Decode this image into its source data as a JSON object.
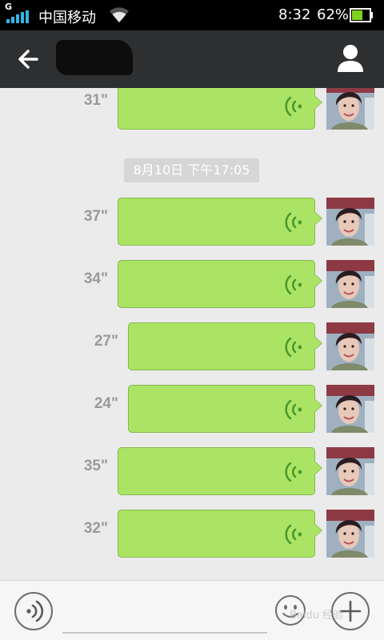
{
  "status_bar": {
    "network_type": "G",
    "carrier": "中国移动",
    "time": "8:32",
    "battery_percent": "62%",
    "battery_level": 0.62,
    "signal_strength": 4,
    "icons": [
      "signal-icon",
      "wifi-icon",
      "battery-icon"
    ]
  },
  "header": {
    "back_icon": "back-arrow-icon",
    "contact_name": "",
    "profile_icon": "person-icon",
    "background": "#2d2f31"
  },
  "chat": {
    "messages": [
      {
        "duration": "31\"",
        "type": "voice",
        "sender": "self"
      },
      {
        "timestamp": "8月10日 下午17:05"
      },
      {
        "duration": "37\"",
        "type": "voice",
        "sender": "self"
      },
      {
        "duration": "34\"",
        "type": "voice",
        "sender": "self"
      },
      {
        "duration": "27\"",
        "type": "voice",
        "sender": "self"
      },
      {
        "duration": "24\"",
        "type": "voice",
        "sender": "self"
      },
      {
        "duration": "35\"",
        "type": "voice",
        "sender": "self"
      },
      {
        "duration": "32\"",
        "type": "voice",
        "sender": "self"
      }
    ],
    "bubble_color": "#abe465",
    "voice_icon": "voice-wave-icon"
  },
  "input_bar": {
    "voice_toggle_icon": "voice-mode-icon",
    "text_value": "",
    "emoji_icon": "emoji-icon",
    "plus_icon": "plus-icon",
    "watermark": "Baidu 经验"
  }
}
